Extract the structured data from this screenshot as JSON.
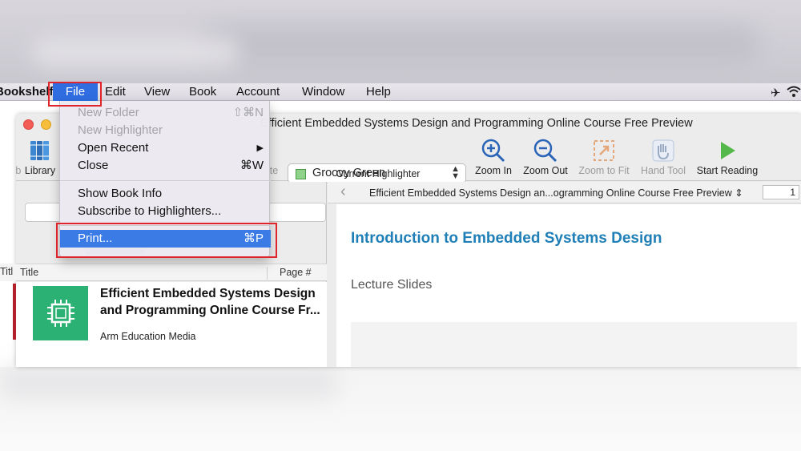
{
  "menubar": {
    "app": "Bookshelf",
    "file": "File",
    "edit": "Edit",
    "view": "View",
    "book": "Book",
    "account": "Account",
    "window": "Window",
    "help": "Help"
  },
  "window": {
    "title": "Efficient Embedded Systems Design and Programming Online Course Free Preview"
  },
  "toolbar": {
    "library": "Library",
    "current_highlighter_label": "Current Highlighter",
    "highlighter_value": "Groovy Green",
    "zoom_in": "Zoom In",
    "zoom_out": "Zoom Out",
    "zoom_to_fit": "Zoom to Fit",
    "hand_tool": "Hand Tool",
    "start_reading": "Start Reading",
    "partial_left": "Lib",
    "partial_note": "te"
  },
  "file_menu": {
    "items": [
      {
        "label": "New Folder",
        "shortcut": "⇧⌘N",
        "enabled": false
      },
      {
        "label": "New Highlighter",
        "shortcut": "",
        "enabled": false
      },
      {
        "label": "Open Recent",
        "shortcut": "▶",
        "enabled": true
      },
      {
        "label": "Close",
        "shortcut": "⌘W",
        "enabled": true
      },
      {
        "label": "Show Book Info",
        "shortcut": "",
        "enabled": true
      },
      {
        "label": "Subscribe to Highlighters...",
        "shortcut": "",
        "enabled": true
      },
      {
        "label": "Print...",
        "shortcut": "⌘P",
        "enabled": true,
        "selected": true
      }
    ]
  },
  "library": {
    "columns": {
      "title": "Title",
      "page": "Page #",
      "partial": "Titl"
    },
    "book": {
      "title": "Efficient Embedded Systems Design and Programming Online Course Fr...",
      "author": "Arm Education Media"
    }
  },
  "reader": {
    "doc_name": "Efficient Embedded Systems Design an...ogramming Online Course Free Preview",
    "page_number": "1",
    "heading": "Introduction to Embedded Systems Design",
    "subheading": "Lecture Slides"
  },
  "colors": {
    "accent": "#2f6de0",
    "highlight_box": "#e0242b",
    "heading": "#1f7fb6",
    "book_cover": "#2ab173",
    "groovy_green": "#8fd28a"
  }
}
